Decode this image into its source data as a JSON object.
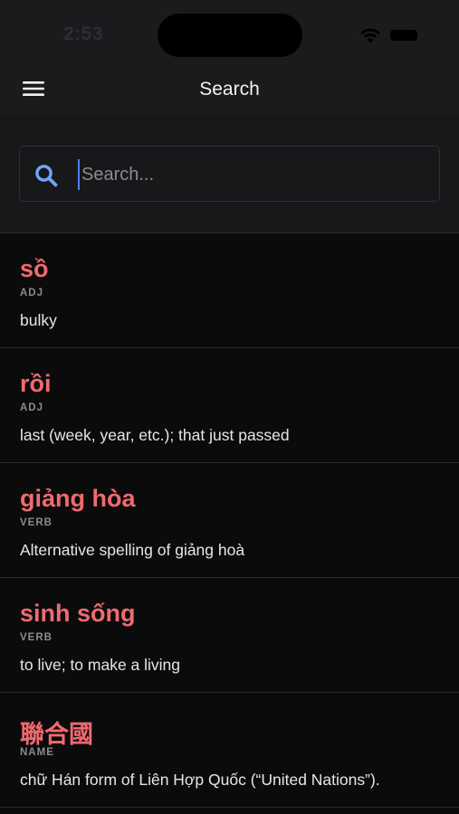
{
  "status_bar": {
    "time": "2:53"
  },
  "nav": {
    "title": "Search",
    "menu_icon": "hamburger-menu-icon"
  },
  "search": {
    "placeholder": "Search...",
    "value": "",
    "icon": "search-icon",
    "accent_color": "#4f7bff"
  },
  "colors": {
    "headword": "#f06a6f",
    "background": "#0b0b0c",
    "header_background": "#1a1b1d"
  },
  "results": [
    {
      "word": "sồ",
      "pos": "ADJ",
      "definition": "bulky"
    },
    {
      "word": "rồi",
      "pos": "ADJ",
      "definition": "last (week, year, etc.); that just passed"
    },
    {
      "word": "giảng hòa",
      "pos": "VERB",
      "definition": "Alternative spelling of giảng hoà"
    },
    {
      "word": "sinh sống",
      "pos": "VERB",
      "definition": "to live; to make a living"
    },
    {
      "word": "聯合國",
      "pos": "NAME",
      "definition": "chữ Hán form of Liên Hợp Quốc (“United Nations”)."
    }
  ]
}
